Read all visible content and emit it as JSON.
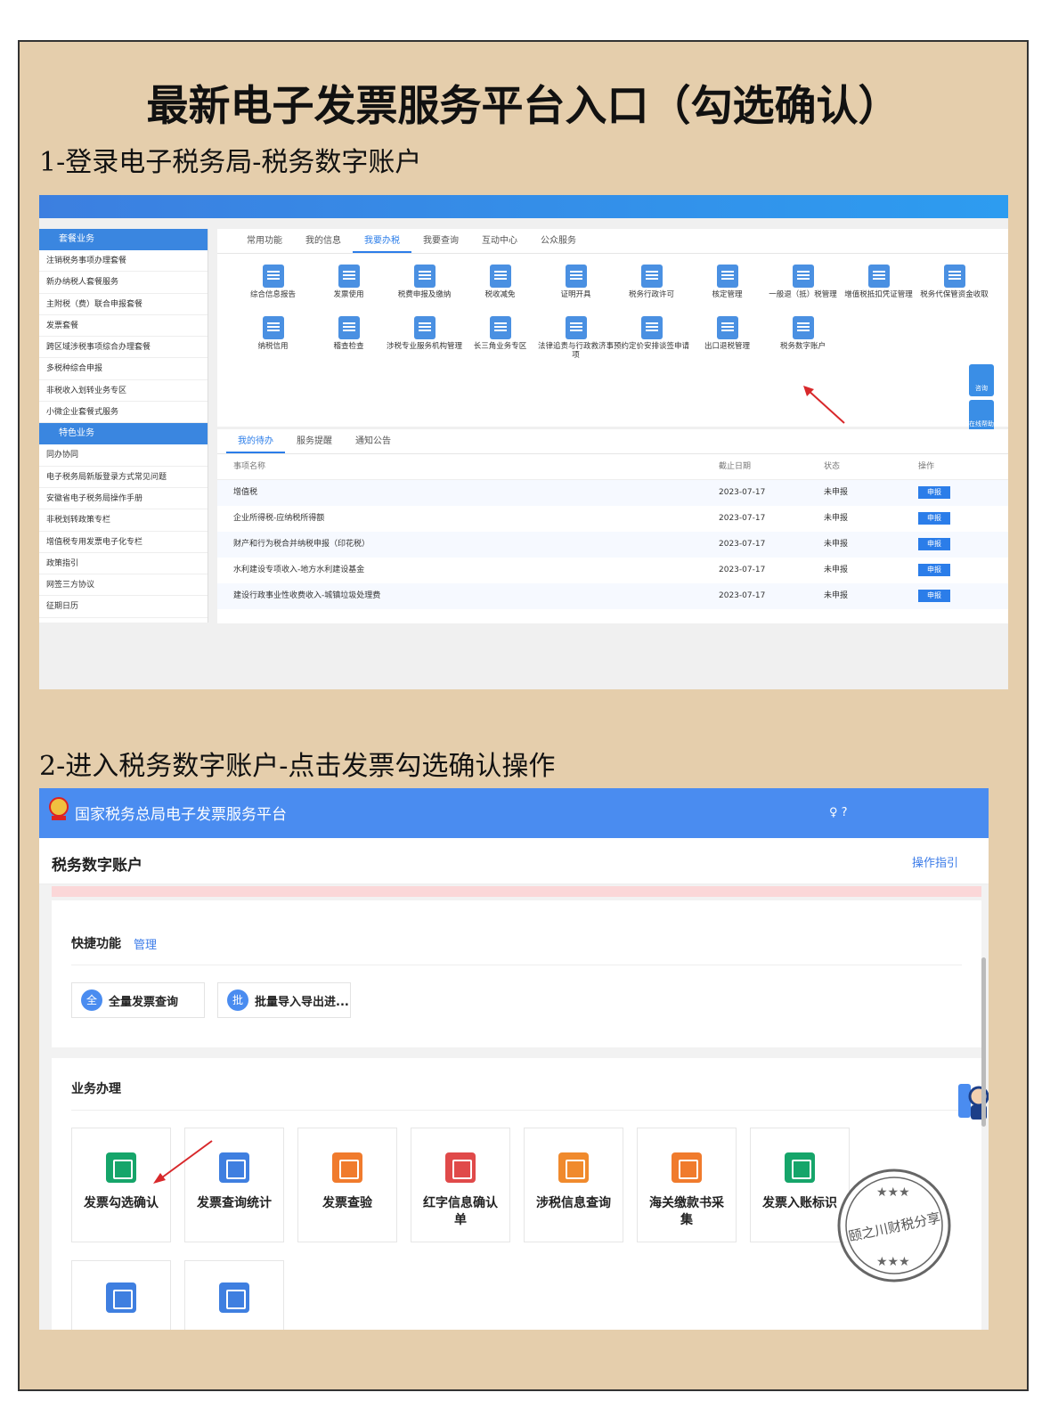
{
  "poster_title": "最新电子发票服务平台入口（勾选确认）",
  "step1": "1-登录电子税务局-税务数字账户",
  "step2": "2-进入税务数字账户-点击发票勾选确认操作",
  "shot1": {
    "sidebar": {
      "section1": "套餐业务",
      "items1": [
        "注销税务事项办理套餐",
        "新办纳税人套餐服务",
        "主附税（费）联合申报套餐",
        "发票套餐",
        "跨区域涉税事项综合办理套餐",
        "多税种综合申报",
        "非税收入划转业务专区",
        "小微企业套餐式服务"
      ],
      "section2": "特色业务",
      "items2": [
        "同办协同",
        "电子税务局新版登录方式常见问题",
        "安徽省电子税务局操作手册",
        "非税划转政策专栏",
        "增值税专用发票电子化专栏",
        "政策指引",
        "网签三方协议",
        "征期日历"
      ]
    },
    "tabs": [
      "常用功能",
      "我的信息",
      "我要办税",
      "我要查询",
      "互动中心",
      "公众服务"
    ],
    "active_tab": "我要办税",
    "functions": [
      "综合信息报告",
      "发票使用",
      "税费申报及缴纳",
      "税收减免",
      "证明开具",
      "税务行政许可",
      "核定管理",
      "一般退（抵）税管理",
      "增值税抵扣凭证管理",
      "税务代保管资金收取",
      "纳税信用",
      "稽查检查",
      "涉税专业服务机构管理",
      "长三角业务专区",
      "法律追责与行政救济事项",
      "预约定价安排谈签申请",
      "出口退税管理",
      "税务数字账户"
    ],
    "float_btns": [
      "咨询",
      "在线帮助"
    ],
    "todo_tabs": [
      "我的待办",
      "服务提醒",
      "通知公告"
    ],
    "todo_headers": [
      "事项名称",
      "截止日期",
      "状态",
      "操作"
    ],
    "todo_rows": [
      {
        "name": "增值税",
        "date": "2023-07-17",
        "status": "未申报",
        "action": "申报"
      },
      {
        "name": "企业所得税-应纳税所得额",
        "date": "2023-07-17",
        "status": "未申报",
        "action": "申报"
      },
      {
        "name": "财产和行为税合并纳税申报（印花税）",
        "date": "2023-07-17",
        "status": "未申报",
        "action": "申报"
      },
      {
        "name": "水利建设专项收入-地方水利建设基金",
        "date": "2023-07-17",
        "status": "未申报",
        "action": "申报"
      },
      {
        "name": "建设行政事业性收费收入-城镇垃圾处理费",
        "date": "2023-07-17",
        "status": "未申报",
        "action": "申报"
      }
    ]
  },
  "shot2": {
    "platform": "国家税务总局电子发票服务平台",
    "user_icons": "♀ ?",
    "page_title": "税务数字账户",
    "guide": "操作指引",
    "quick_title": "快捷功能",
    "quick_manage": "管理",
    "quick_items": [
      {
        "icon": "全",
        "label": "全量发票查询"
      },
      {
        "icon": "批",
        "label": "批量导入导出进..."
      }
    ],
    "biz_title": "业务办理",
    "cards": [
      {
        "label": "发票勾选确认",
        "color": "#16a56a"
      },
      {
        "label": "发票查询统计",
        "color": "#3f7fe0"
      },
      {
        "label": "发票查验",
        "color": "#f07b2d"
      },
      {
        "label": "红字信息确认单",
        "color": "#e04a4a"
      },
      {
        "label": "涉税信息查询",
        "color": "#f08a2d"
      },
      {
        "label": "海关缴款书采集",
        "color": "#f07b2d"
      },
      {
        "label": "发票入账标识",
        "color": "#16a56a"
      },
      {
        "label": "",
        "color": "#3f7fe0"
      },
      {
        "label": "",
        "color": "#3f7fe0"
      }
    ],
    "stamp_text": "颐之川财税分享"
  }
}
